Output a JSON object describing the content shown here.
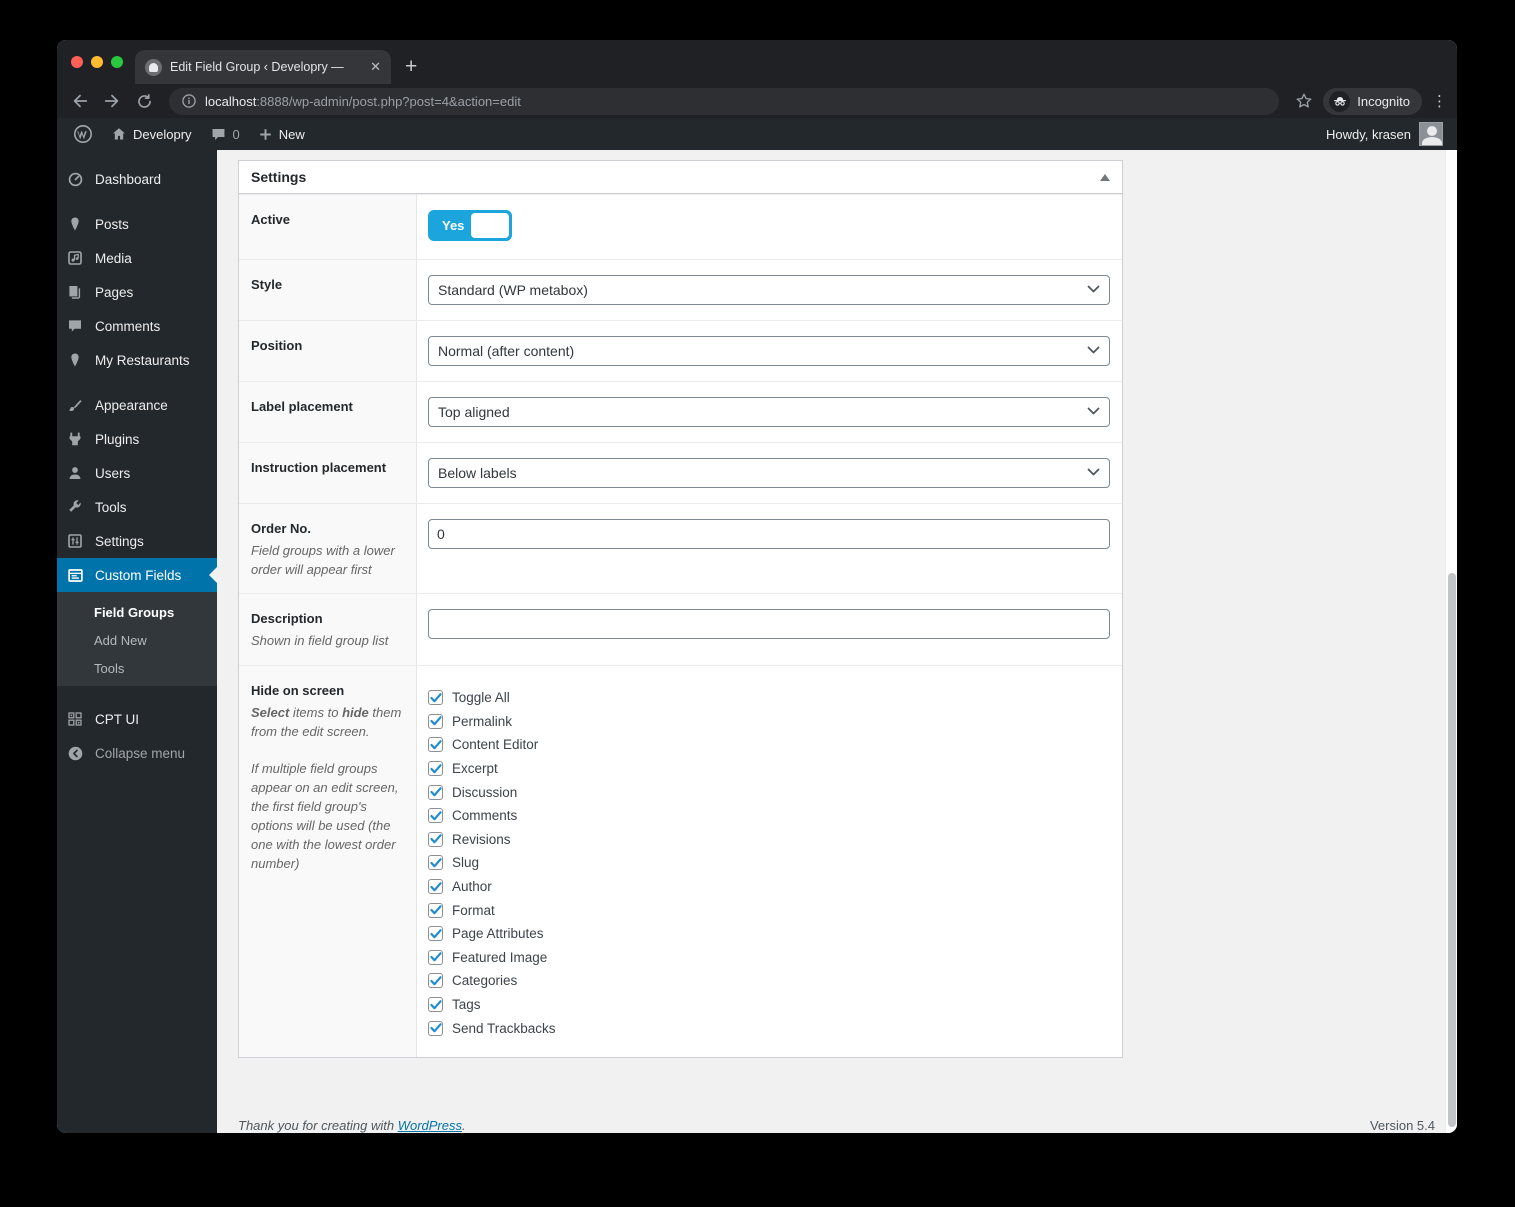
{
  "browser": {
    "tab_title": "Edit Field Group ‹ Developry —",
    "close_glyph": "✕",
    "new_tab_glyph": "+",
    "url_host": "localhost",
    "url_rest": ":8888/wp-admin/post.php?post=4&action=edit",
    "incognito_label": "Incognito",
    "kebab_glyph": "⋮"
  },
  "admin_bar": {
    "site_name": "Developry",
    "comments_count": "0",
    "new_label": "New",
    "howdy": "Howdy, krasen"
  },
  "sidebar": {
    "items": [
      {
        "label": "Dashboard"
      },
      {
        "label": "Posts"
      },
      {
        "label": "Media"
      },
      {
        "label": "Pages"
      },
      {
        "label": "Comments"
      },
      {
        "label": "My Restaurants"
      },
      {
        "label": "Appearance"
      },
      {
        "label": "Plugins"
      },
      {
        "label": "Users"
      },
      {
        "label": "Tools"
      },
      {
        "label": "Settings"
      },
      {
        "label": "Custom Fields"
      }
    ],
    "submenu": {
      "field_groups": "Field Groups",
      "add_new": "Add New",
      "tools": "Tools"
    },
    "cpt_ui": "CPT UI",
    "collapse": "Collapse menu"
  },
  "settings_panel": {
    "title": "Settings",
    "active": {
      "label": "Active",
      "value": "Yes"
    },
    "style": {
      "label": "Style",
      "value": "Standard (WP metabox)"
    },
    "position": {
      "label": "Position",
      "value": "Normal (after content)"
    },
    "label_placement": {
      "label": "Label placement",
      "value": "Top aligned"
    },
    "instruction_placement": {
      "label": "Instruction placement",
      "value": "Below labels"
    },
    "order": {
      "label": "Order No.",
      "description": "Field groups with a lower order will appear first",
      "value": "0"
    },
    "description": {
      "label": "Description",
      "description": "Shown in field group list",
      "value": ""
    },
    "hide_on_screen": {
      "label": "Hide on screen",
      "desc1_bold1": "Select",
      "desc1_mid": " items to ",
      "desc1_bold2": "hide",
      "desc1_end": " them from the edit screen.",
      "desc2": "If multiple field groups appear on an edit screen, the first field group's options will be used (the one with the lowest order number)",
      "options": [
        "Toggle All",
        "Permalink",
        "Content Editor",
        "Excerpt",
        "Discussion",
        "Comments",
        "Revisions",
        "Slug",
        "Author",
        "Format",
        "Page Attributes",
        "Featured Image",
        "Categories",
        "Tags",
        "Send Trackbacks"
      ]
    }
  },
  "footer": {
    "thanks_prefix": "Thank you for creating with ",
    "link_label": "WordPress",
    "thanks_suffix": ".",
    "version": "Version 5.4"
  },
  "colors": {
    "menu_active": "#0073aa",
    "toggle_on": "#1ca5dc",
    "checkbox_check": "#1e8cd1",
    "link": "#0073aa"
  }
}
